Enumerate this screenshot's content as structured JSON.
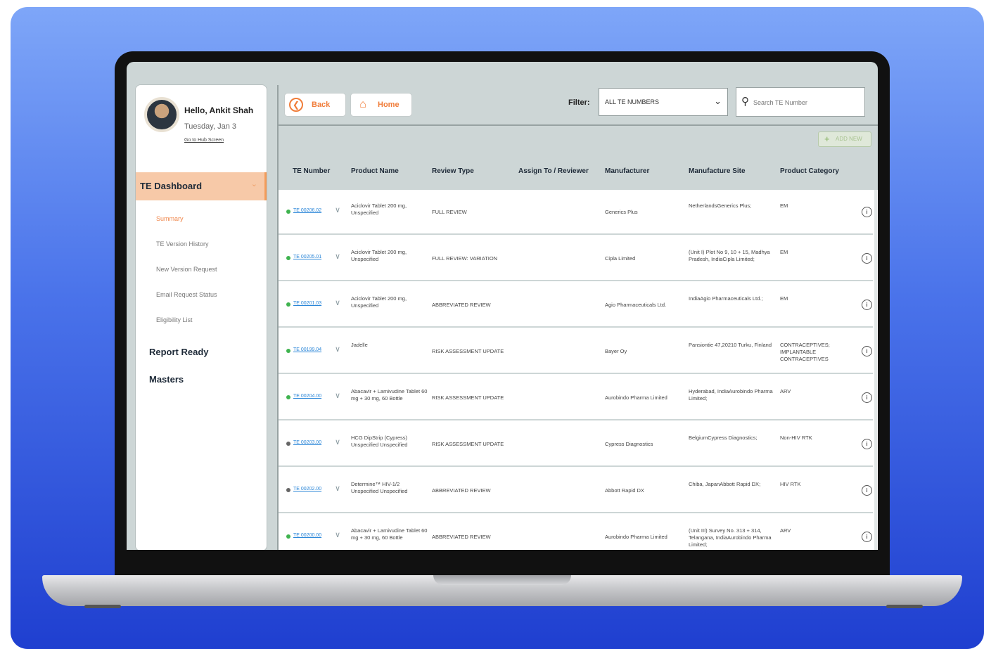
{
  "user": {
    "greeting": "Hello, Ankit Shah",
    "date": "Tuesday, Jan 3",
    "hub_link": "Go to Hub Screen"
  },
  "sidebar": {
    "active": "TE Dashboard",
    "items": [
      "Summary",
      "TE Version History",
      "New Version Request",
      "Email Request Status",
      "Eligibility List"
    ],
    "sections": [
      "Report Ready",
      "Masters"
    ]
  },
  "toolbar": {
    "back_label": "Back",
    "home_label": "Home",
    "filter_label": "Filter:",
    "filter_value": "ALL TE NUMBERS",
    "search_placeholder": "Search TE Number",
    "add_new_label": "ADD NEW"
  },
  "table": {
    "headers": [
      "TE Number",
      "Product Name",
      "Review Type",
      "Assign To / Reviewer",
      "Manufacturer",
      "Manufacture Site",
      "Product Category"
    ],
    "rows": [
      {
        "te": "TE 00206.02",
        "status": "green",
        "product": "Aciclovir Tablet 200 mg, Unspecified",
        "review": "FULL REVIEW",
        "assignee": "",
        "manufacturer": "Generics Plus",
        "site": "NetherlandsGenerics Plus;",
        "category": "EM"
      },
      {
        "te": "TE 00205.01",
        "status": "green",
        "product": "Aciclovir Tablet 200 mg, Unspecified",
        "review": "FULL REVIEW: VARIATION",
        "assignee": "",
        "manufacturer": "Cipla Limited",
        "site": "(Unit I) Plot No 9, 10 + 15, Madhya Pradesh, IndiaCipla Limited;",
        "category": "EM"
      },
      {
        "te": "TE 00201.03",
        "status": "green",
        "product": "Aciclovir Tablet 200 mg, Unspecified",
        "review": "ABBREVIATED REVIEW",
        "assignee": "",
        "manufacturer": "Agio Pharmaceuticals Ltd.",
        "site": "IndiaAgio Pharmaceuticals Ltd.;",
        "category": "EM"
      },
      {
        "te": "TE 00199.04",
        "status": "green",
        "product": "Jadelle",
        "review": "RISK ASSESSMENT UPDATE",
        "assignee": "",
        "manufacturer": "Bayer Oy",
        "site": "Pansiontie 47,20210 Turku, Finland",
        "category": "CONTRACEPTIVES; IMPLANTABLE CONTRACEPTIVES"
      },
      {
        "te": "TE 00204.00",
        "status": "green",
        "product": "Abacavir + Lamivudine Tablet 60 mg + 30 mg, 60 Bottle",
        "review": "RISK ASSESSMENT UPDATE",
        "assignee": "",
        "manufacturer": "Aurobindo Pharma Limited",
        "site": "Hyderabad, IndiaAurobindo Pharma Limited;",
        "category": "ARV"
      },
      {
        "te": "TE 00203.00",
        "status": "gray",
        "product": "HCG DipStrip (Cypress) Unspecified Unspecified",
        "review": "RISK ASSESSMENT UPDATE",
        "assignee": "",
        "manufacturer": "Cypress Diagnostics",
        "site": "BelgiumCypress Diagnostics;",
        "category": "Non-HIV RTK"
      },
      {
        "te": "TE 00202.00",
        "status": "gray",
        "product": "Determine™ HIV-1/2 Unspecified Unspecified",
        "review": "ABBREVIATED REVIEW",
        "assignee": "",
        "manufacturer": "Abbott Rapid DX",
        "site": "Chiba, JapanAbbott Rapid DX;",
        "category": "HIV RTK"
      },
      {
        "te": "TE 00200.00",
        "status": "green",
        "product": "Abacavir + Lamivudine Tablet 60 mg + 30 mg, 60 Bottle",
        "review": "ABBREVIATED REVIEW",
        "assignee": "",
        "manufacturer": "Aurobindo Pharma Limited",
        "site": "(Unit III) Survey No. 313 + 314, Telangana, IndiaAurobindo Pharma Limited;",
        "category": "ARV"
      }
    ]
  },
  "colors": {
    "accent": "#f07d3a",
    "active_nav_bg": "#f7c9a8",
    "link": "#2a86d8",
    "status_green": "#3fb34f",
    "status_gray": "#666666"
  }
}
